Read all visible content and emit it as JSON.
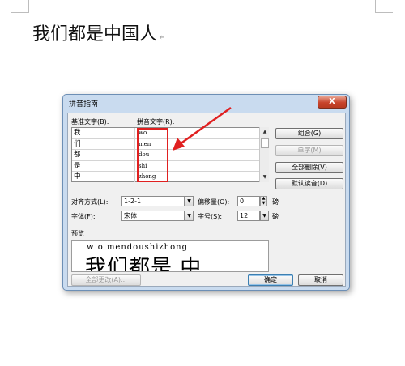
{
  "document": {
    "text": "我们都是中国人",
    "paragraph_mark": "↵"
  },
  "dialog": {
    "title": "拼音指南",
    "close_label": "X",
    "base_label": "基准文字(B):",
    "pinyin_label": "拼音文字(R):",
    "rows": [
      {
        "base": "我",
        "pinyin": "wo"
      },
      {
        "base": "们",
        "pinyin": "men"
      },
      {
        "base": "都",
        "pinyin": "dou"
      },
      {
        "base": "是",
        "pinyin": "shi"
      },
      {
        "base": "中",
        "pinyin": "zhong"
      }
    ],
    "buttons": {
      "combine": "组合(G)",
      "single": "单字(M)",
      "clear_all": "全部删除(V)",
      "default_reading": "默认读音(D)",
      "change_all": "全部更改(A)...",
      "ok": "确定",
      "cancel": "取消"
    },
    "alignment_label": "对齐方式(L):",
    "alignment_value": "1-2-1",
    "offset_label": "偏移量(O):",
    "offset_value": "0",
    "offset_unit": "磅",
    "font_label": "字体(F):",
    "font_value": "宋体",
    "size_label": "字号(S):",
    "size_value": "12",
    "size_unit": "磅",
    "preview_label": "预览",
    "preview_pinyin": "w o mendoushizhong",
    "preview_chars": "我们都是 中"
  },
  "colors": {
    "annotation_red": "#e02020",
    "title_bar": "#c9dbef"
  }
}
